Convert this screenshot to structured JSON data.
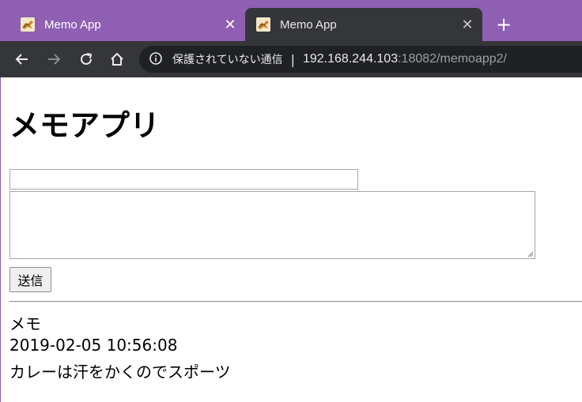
{
  "browser": {
    "tabs": [
      {
        "title": "Memo App",
        "active": false
      },
      {
        "title": "Memo App",
        "active": true
      }
    ],
    "tab_close_glyph": "✕",
    "new_tab_glyph": "+",
    "address": {
      "security_label": "保護されていない通信",
      "separator": "|",
      "host": "192.168.244.103",
      "port_path": ":18082/memoapp2/"
    },
    "colors": {
      "tabstrip": "#8e5fb3",
      "toolbar": "#35363a",
      "omnibox": "#202124"
    }
  },
  "page": {
    "heading": "メモアプリ",
    "title_input_value": "",
    "body_textarea_value": "",
    "submit_label": "送信",
    "memo": {
      "label": "メモ",
      "timestamp": "2019-02-05 10:56:08",
      "text": "カレーは汗をかくのでスポーツ"
    }
  }
}
